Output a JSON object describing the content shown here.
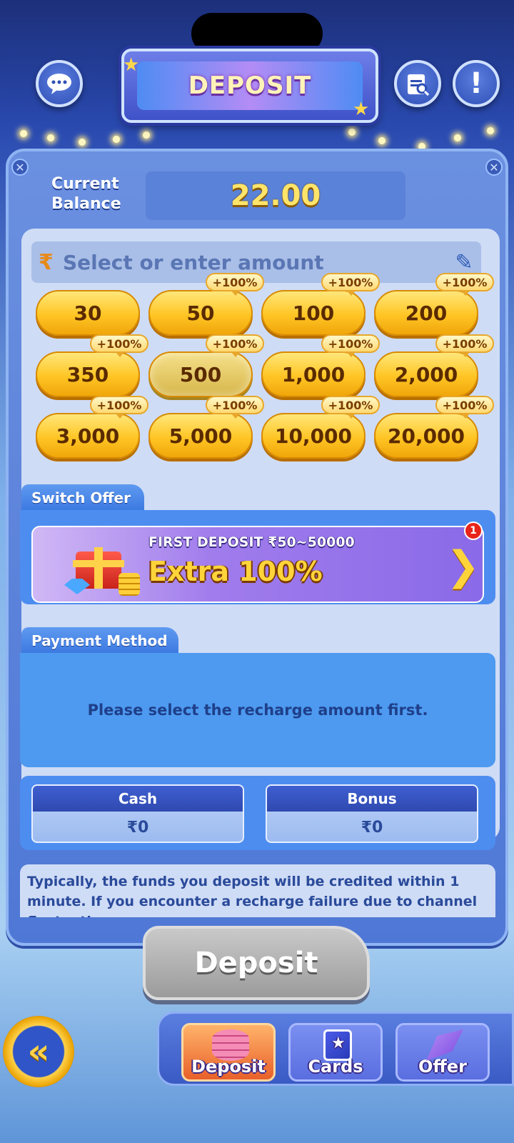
{
  "header": {
    "title": "DEPOSIT",
    "support_icon": "chat-support-icon",
    "records_icon": "records-icon",
    "info_icon": "exclamation-icon"
  },
  "balance": {
    "label_line1": "Current",
    "label_line2": "Balance",
    "value": "22.00"
  },
  "amount_input": {
    "placeholder": "Select or enter amount",
    "currency_symbol": "₹"
  },
  "amounts": [
    {
      "label": "30",
      "bonus": ""
    },
    {
      "label": "50",
      "bonus": "+100%"
    },
    {
      "label": "100",
      "bonus": "+100%"
    },
    {
      "label": "200",
      "bonus": "+100%"
    },
    {
      "label": "350",
      "bonus": "+100%"
    },
    {
      "label": "500",
      "bonus": "+100%"
    },
    {
      "label": "1,000",
      "bonus": "+100%"
    },
    {
      "label": "2,000",
      "bonus": "+100%"
    },
    {
      "label": "3,000",
      "bonus": "+100%"
    },
    {
      "label": "5,000",
      "bonus": "+100%"
    },
    {
      "label": "10,000",
      "bonus": "+100%"
    },
    {
      "label": "20,000",
      "bonus": "+100%"
    }
  ],
  "switch_offer": {
    "tab_label": "Switch Offer",
    "title": "FIRST DEPOSIT ₹50~50000",
    "headline": "Extra 100%",
    "badge_count": "1"
  },
  "payment_method": {
    "tab_label": "Payment Method",
    "message": "Please select the recharge amount first."
  },
  "wallet": {
    "cash_label": "Cash",
    "cash_value": "₹0",
    "bonus_label": "Bonus",
    "bonus_value": "₹0"
  },
  "notice": {
    "text": "Typically, the funds you deposit will be credited within 1 minute. If you encounter a recharge failure due to channel fluctuations, we"
  },
  "deposit_button": {
    "label": "Deposit"
  },
  "bottom_nav": {
    "back_icon": "double-chevron-left-icon",
    "tabs": [
      {
        "label": "Deposit",
        "active": true
      },
      {
        "label": "Cards",
        "active": false
      },
      {
        "label": "Offer",
        "active": false
      }
    ]
  }
}
